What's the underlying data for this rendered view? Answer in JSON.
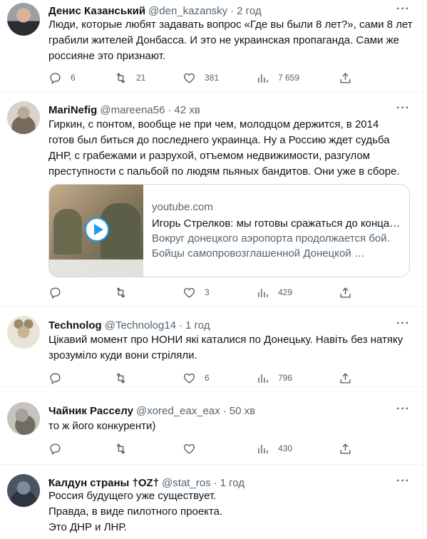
{
  "tweets": [
    {
      "name": "Денис Казанський",
      "handle": "@den_kazansky",
      "time": "2 год",
      "lines": [
        "Люди, которые любят задавать вопрос «Где вы были 8 лет?», сами 8 лет",
        "грабили жителей Донбасса. И это не украинская пропаганда. Сами же",
        "россияне это признают."
      ],
      "replies": "6",
      "retweets": "21",
      "likes": "381",
      "views": "7 659"
    },
    {
      "name": "MariNefig",
      "handle": "@mareena56",
      "time": "42 хв",
      "lines": [
        "Гиркин, с понтом, вообще не при чем, молодцом держится, в 2014",
        "готов был биться до последнего украинца. Ну а Россию ждет судьба",
        "ДНР, с грабежами и разрухой, отъемом  недвижимости, разгулом",
        "преступности с пальбой по людям пьяных бандитов. Они уже в сборе."
      ],
      "card": {
        "domain": "youtube.com",
        "title": "Игорь Стрелков: мы готовы сражаться до конца…",
        "desc1": "Вокруг донецкого аэропорта продолжается бой.",
        "desc2": "Бойцы самопровозглашенной Донецкой …"
      },
      "replies": "",
      "retweets": "",
      "likes": "3",
      "views": "429"
    },
    {
      "name": "Technolog",
      "handle": "@Technolog14",
      "time": "1 год",
      "lines": [
        "Цікавий момент про НОНИ які каталися по Донецьку. Навіть без натяку",
        "зрозуміло куди вони стріляли."
      ],
      "replies": "",
      "retweets": "",
      "likes": "6",
      "views": "796"
    },
    {
      "name": "Чайник Расселу",
      "handle": "@xored_eax_eax",
      "time": "50 хв",
      "lines": [
        "то ж його конкуренти)"
      ],
      "replies": "",
      "retweets": "",
      "likes": "",
      "views": "430"
    },
    {
      "name": "Ҟалдун страны †ΟZ†",
      "handle": "@stat_ros",
      "time": "1 год",
      "lines": [
        "Россия будущего уже существует.",
        "Правда, в виде пилотного проекта.",
        "Это ДНР и ЛНР."
      ]
    }
  ],
  "dot": "·",
  "more": "···",
  "colors": {
    "text": "#0f1419",
    "secondary": "#536471",
    "accent": "#1d9bf0",
    "border": "#eff3f4"
  }
}
